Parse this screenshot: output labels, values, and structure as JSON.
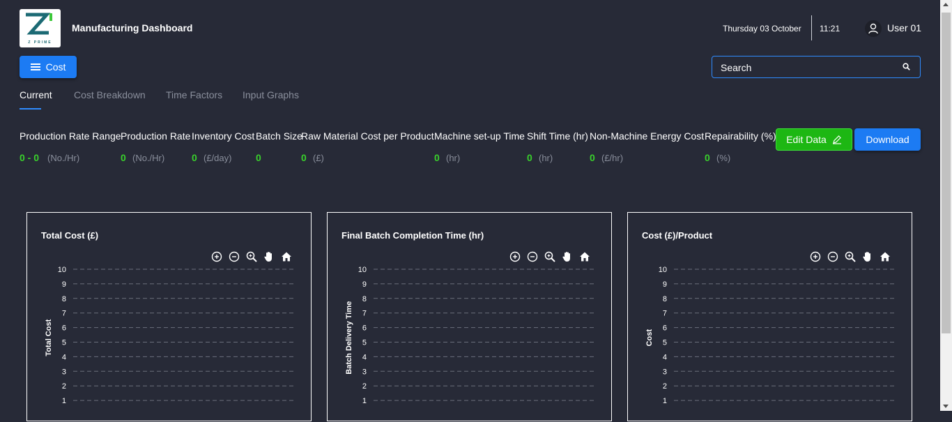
{
  "header": {
    "logo_text": "Z PRIME",
    "title": "Manufacturing Dashboard",
    "date": "Thursday 03 October",
    "time": "11:21",
    "user": "User 01"
  },
  "menu_button": {
    "label": "Cost",
    "icon": "hamburger-icon"
  },
  "search": {
    "placeholder": "Search",
    "value": ""
  },
  "tabs": [
    {
      "label": "Current",
      "active": true
    },
    {
      "label": "Cost Breakdown",
      "active": false
    },
    {
      "label": "Time Factors",
      "active": false
    },
    {
      "label": "Input Graphs",
      "active": false
    }
  ],
  "stats": [
    {
      "label": "Production Rate Range",
      "value": "0 - 0",
      "unit": "(No./Hr)"
    },
    {
      "label": "Production Rate",
      "value": "0",
      "unit": "(No./Hr)"
    },
    {
      "label": "Inventory Cost",
      "value": "0",
      "unit": "(£/day)"
    },
    {
      "label": "Batch Size",
      "value": "0",
      "unit": ""
    },
    {
      "label": "Raw Material Cost per Product",
      "value": "0",
      "unit": "(£)"
    },
    {
      "label": "Machine set-up Time",
      "value": "0",
      "unit": "(hr)"
    },
    {
      "label": "Shift Time (hr)",
      "value": "0",
      "unit": "(hr)"
    },
    {
      "label": "Non-Machine Energy Cost",
      "value": "0",
      "unit": "(£/hr)"
    },
    {
      "label": "Repairability (%)",
      "value": "0",
      "unit": "(%)"
    }
  ],
  "actions": {
    "edit_label": "Edit Data",
    "download_label": "Download"
  },
  "colors": {
    "accent": "#1c7bf3",
    "success": "#1db713",
    "value_green": "#39d02c",
    "background": "#272a37"
  },
  "chart_toolbar": [
    "zoom-in-icon",
    "zoom-out-icon",
    "zoom-select-icon",
    "pan-icon",
    "home-icon"
  ],
  "chart_data": [
    {
      "type": "line",
      "title": "Total Cost (£)",
      "ylabel": "Total Cost",
      "xlabel": "",
      "ylim": [
        0,
        10
      ],
      "yticks": [
        1,
        2,
        3,
        4,
        5,
        6,
        7,
        8,
        9,
        10
      ],
      "grid": true,
      "series": []
    },
    {
      "type": "line",
      "title": "Final Batch Completion Time (hr)",
      "ylabel": "Batch Delivery Time",
      "xlabel": "",
      "ylim": [
        0,
        10
      ],
      "yticks": [
        1,
        2,
        3,
        4,
        5,
        6,
        7,
        8,
        9,
        10
      ],
      "grid": true,
      "series": []
    },
    {
      "type": "line",
      "title": "Cost (£)/Product",
      "ylabel": "Cost",
      "xlabel": "",
      "ylim": [
        0,
        10
      ],
      "yticks": [
        1,
        2,
        3,
        4,
        5,
        6,
        7,
        8,
        9,
        10
      ],
      "grid": true,
      "series": []
    }
  ]
}
